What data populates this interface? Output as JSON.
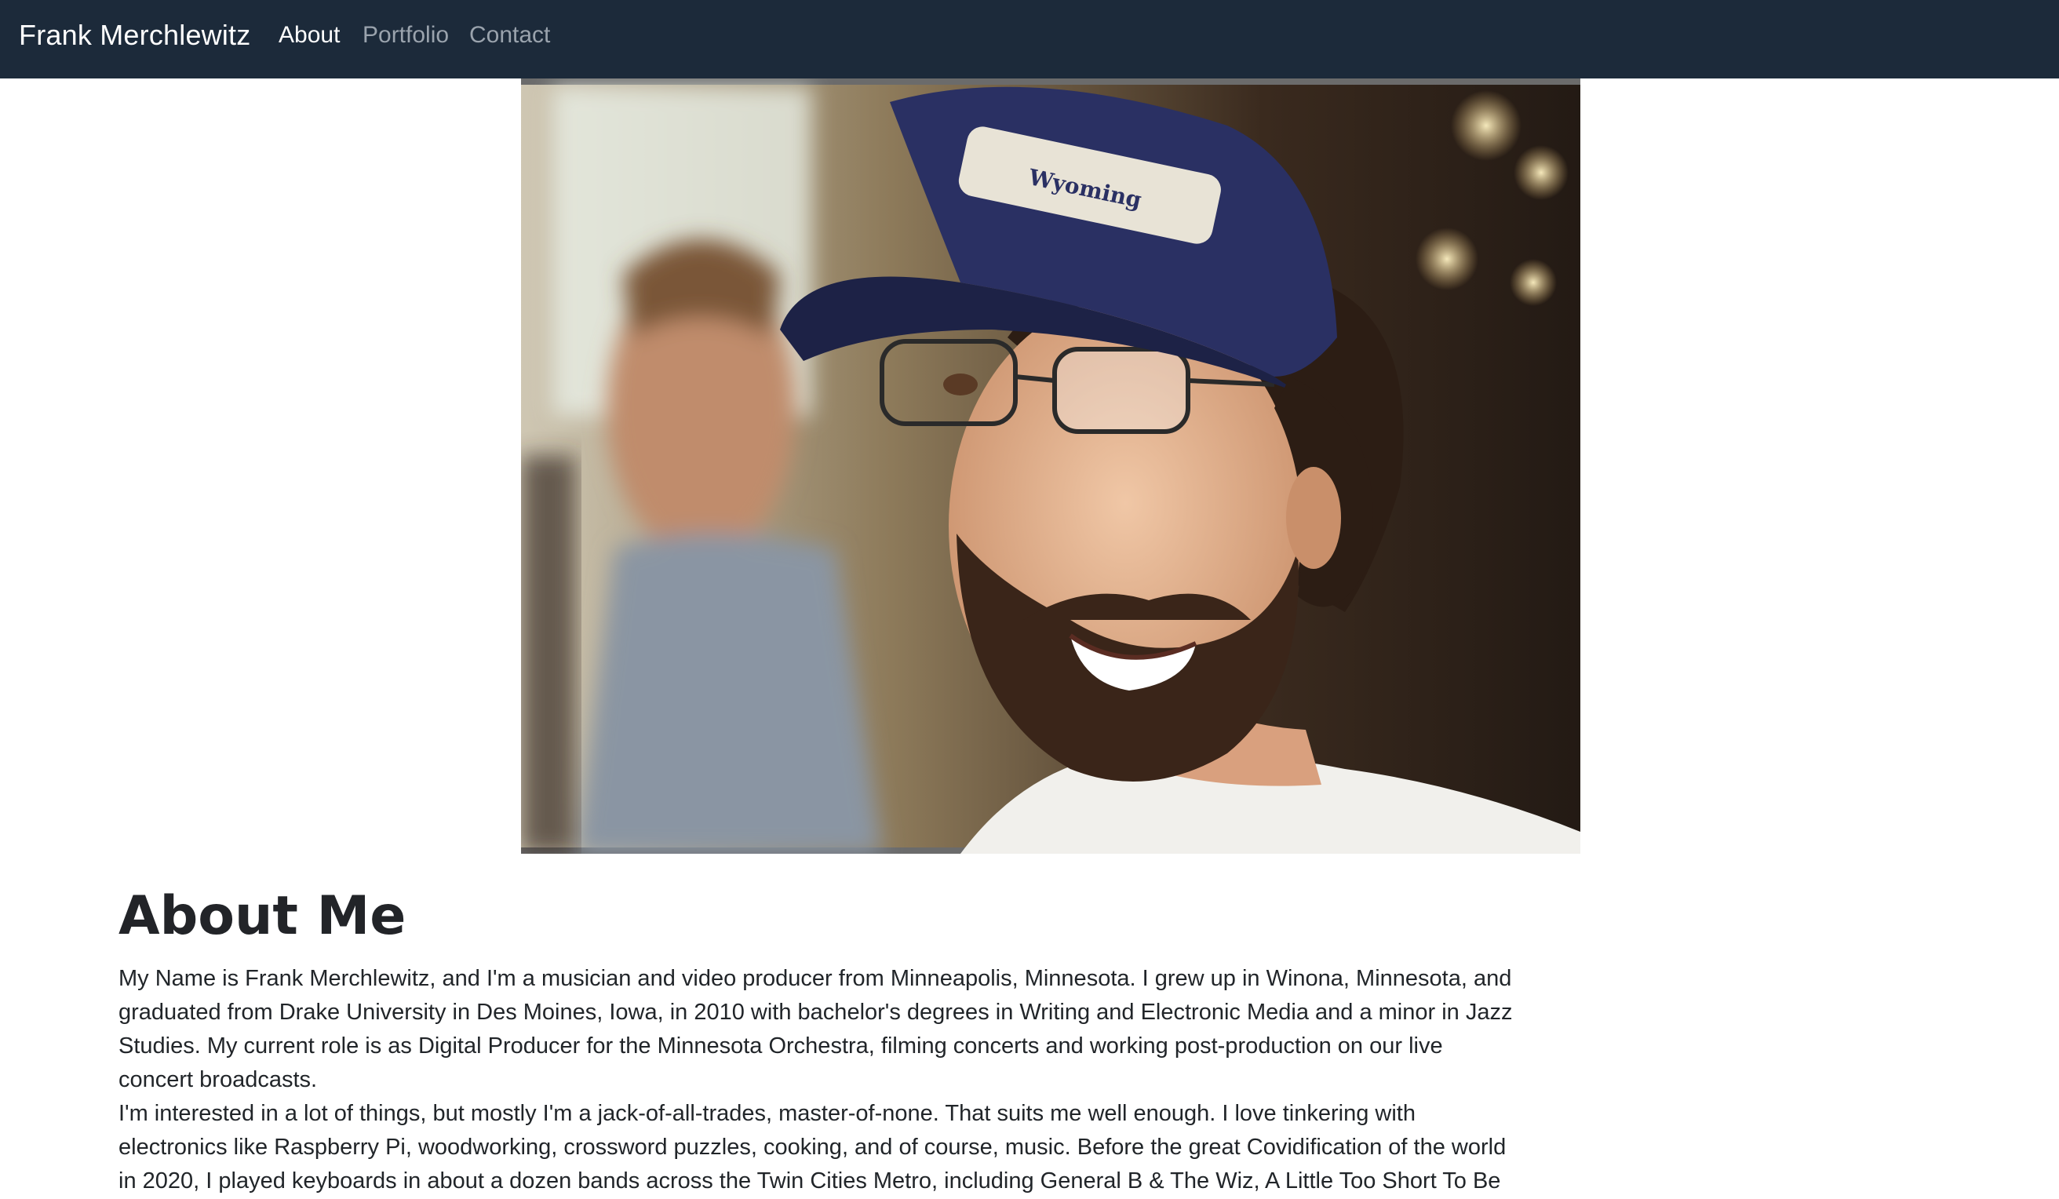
{
  "navbar": {
    "brand": "Frank Merchlewitz",
    "links": [
      {
        "label": "About",
        "active": true
      },
      {
        "label": "Portfolio",
        "active": false
      },
      {
        "label": "Contact",
        "active": false
      }
    ],
    "background": "#1c2a3a"
  },
  "hero": {
    "description_icon": "portrait-photo",
    "cap_text": "Wyoming"
  },
  "about": {
    "heading": "About Me",
    "paragraphs": [
      "My Name is Frank Merchlewitz, and I'm a musician and video producer from Minneapolis, Minnesota. I grew up in Winona, Minnesota, and graduated from Drake University in Des Moines, Iowa, in 2010 with bachelor's degrees in Writing and Electronic Media and a minor in Jazz Studies. My current role is as Digital Producer for the Minnesota Orchestra, filming concerts and working post-production on our live concert broadcasts.",
      "I'm interested in a lot of things, but mostly I'm a jack-of-all-trades, master-of-none. That suits me well enough. I love tinkering with electronics like Raspberry Pi, woodworking, crossword puzzles, cooking, and of course, music. Before the great Covidification of the world in 2020, I played keyboards in about a dozen bands across the Twin Cities Metro, including General B & The Wiz, A Little Too Short To Be"
    ]
  }
}
